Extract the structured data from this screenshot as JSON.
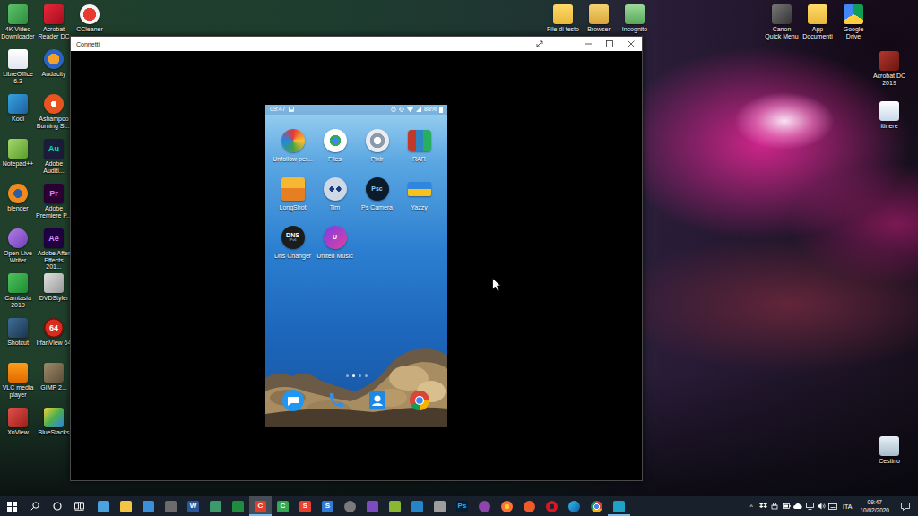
{
  "desktop": {
    "columns": [
      [
        {
          "label": "4K Video Downloader",
          "glyph": ""
        },
        {
          "label": "LibreOffice 6.3",
          "glyph": ""
        },
        {
          "label": "Kodi",
          "glyph": ""
        },
        {
          "label": "Notepad++",
          "glyph": ""
        },
        {
          "label": "blender",
          "glyph": ""
        },
        {
          "label": "Open Live Writer",
          "glyph": ""
        },
        {
          "label": "Camtasia 2019",
          "glyph": ""
        },
        {
          "label": "Shotcut",
          "glyph": ""
        },
        {
          "label": "VLC media player",
          "glyph": ""
        },
        {
          "label": "XnView",
          "glyph": ""
        }
      ],
      [
        {
          "label": "Acrobat Reader DC",
          "glyph": ""
        },
        {
          "label": "Audacity",
          "glyph": ""
        },
        {
          "label": "Ashampoo Burning St...",
          "glyph": ""
        },
        {
          "label": "Adobe Auditi...",
          "glyph": "Au"
        },
        {
          "label": "Adobe Premiere P...",
          "glyph": "Pr"
        },
        {
          "label": "Adobe After Effects 201...",
          "glyph": "Ae"
        },
        {
          "label": "DVDStyler",
          "glyph": ""
        },
        {
          "label": "IrfanView 64",
          "glyph": "64"
        },
        {
          "label": "GIMP 2...",
          "glyph": ""
        },
        {
          "label": "BlueStacks",
          "glyph": ""
        }
      ],
      [
        {
          "label": "CCleaner",
          "glyph": ""
        }
      ]
    ],
    "top_row": [
      {
        "label": "File di testo",
        "glyph": ""
      },
      {
        "label": "Browser",
        "glyph": ""
      },
      {
        "label": "Incognito",
        "glyph": ""
      }
    ],
    "top_right": [
      {
        "label": "Canon Quick Menu",
        "glyph": ""
      },
      {
        "label": "App Documenti",
        "glyph": ""
      },
      {
        "label": "Google Drive",
        "glyph": ""
      }
    ],
    "right_column": [
      {
        "label": "Acrobat DC 2019",
        "glyph": ""
      },
      {
        "label": "itinere",
        "glyph": ""
      }
    ],
    "trash": {
      "label": "Cestino",
      "glyph": ""
    }
  },
  "window": {
    "title": "Connetti"
  },
  "phone": {
    "status_bar": {
      "time": "09:47",
      "battery": "88%"
    },
    "apps": [
      {
        "label": "Unfollow per...",
        "glyph": "",
        "subglyph": ""
      },
      {
        "label": "Files",
        "glyph": "",
        "subglyph": ""
      },
      {
        "label": "Pixlr",
        "glyph": "",
        "subglyph": ""
      },
      {
        "label": "RAR",
        "glyph": "",
        "subglyph": ""
      },
      {
        "label": "LongShot",
        "glyph": "",
        "subglyph": ""
      },
      {
        "label": "Tim",
        "glyph": "",
        "subglyph": ""
      },
      {
        "label": "Ps Camera",
        "glyph": "Psc",
        "subglyph": ""
      },
      {
        "label": "Yazzy",
        "glyph": "",
        "subglyph": ""
      },
      {
        "label": "Dns Changer",
        "glyph": "DNS",
        "subglyph": "IPv6"
      },
      {
        "label": "United Music",
        "glyph": "U",
        "subglyph": ""
      }
    ],
    "page_dots": [
      {
        "selected": false
      },
      {
        "selected": true
      },
      {
        "selected": false
      },
      {
        "selected": false
      }
    ]
  },
  "taskbar": {
    "apps": [
      {
        "glyph": "",
        "running": false,
        "active": false
      },
      {
        "glyph": "",
        "running": false,
        "active": false
      },
      {
        "glyph": "",
        "running": false,
        "active": false
      },
      {
        "glyph": "",
        "running": false,
        "active": false
      },
      {
        "glyph": "W",
        "running": false,
        "active": false
      },
      {
        "glyph": "",
        "running": false,
        "active": false
      },
      {
        "glyph": "",
        "running": false,
        "active": false
      },
      {
        "glyph": "C",
        "running": true,
        "active": true
      },
      {
        "glyph": "C",
        "running": false,
        "active": false
      },
      {
        "glyph": "S",
        "running": false,
        "active": false
      },
      {
        "glyph": "S",
        "running": false,
        "active": false
      },
      {
        "glyph": "",
        "running": false,
        "active": false
      },
      {
        "glyph": "",
        "running": false,
        "active": false
      },
      {
        "glyph": "",
        "running": false,
        "active": false
      },
      {
        "glyph": "",
        "running": false,
        "active": false
      },
      {
        "glyph": "",
        "running": false,
        "active": false
      },
      {
        "glyph": "Ps",
        "running": false,
        "active": false
      },
      {
        "glyph": "",
        "running": false,
        "active": false
      },
      {
        "glyph": "",
        "running": false,
        "active": false
      },
      {
        "glyph": "",
        "running": false,
        "active": false
      },
      {
        "glyph": "",
        "running": false,
        "active": false
      },
      {
        "glyph": "",
        "running": false,
        "active": false
      },
      {
        "glyph": "",
        "running": false,
        "active": false
      },
      {
        "glyph": "",
        "running": true,
        "active": false
      }
    ],
    "tray": {
      "caret": "^",
      "language": "ITA",
      "time": "09:47",
      "date": "10/02/2020"
    }
  }
}
